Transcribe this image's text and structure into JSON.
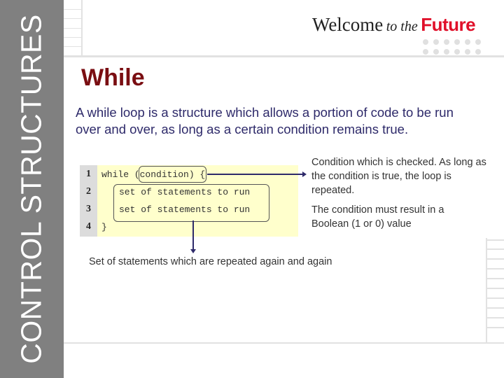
{
  "sidebar": {
    "title": "CONTROL STRUCTURES"
  },
  "logo": {
    "welcome": "Welcome",
    "to_the": "to the",
    "future": "Future"
  },
  "slide": {
    "title": "While",
    "intro": "A while loop is a structure which allows a portion of code to be run over and over, as long as a certain condition remains true."
  },
  "code": {
    "lines": [
      {
        "number": "1",
        "text": "while (condition) {"
      },
      {
        "number": "2",
        "text": "set of statements to run"
      },
      {
        "number": "3",
        "text": "set of statements to run"
      },
      {
        "number": "4",
        "text": "}"
      }
    ]
  },
  "annotations": {
    "condition_note": "Condition which is checked. As long as the condition is true, the loop is repeated.",
    "boolean_note": "The condition must result in a Boolean (1 or 0) value",
    "statements_note": "Set of statements which are repeated again and again"
  },
  "colors": {
    "title": "#7a0e12",
    "intro": "#2e2a6a",
    "future": "#e0102a",
    "sidebar": "#808080",
    "code_bg": "#ffffcc"
  }
}
